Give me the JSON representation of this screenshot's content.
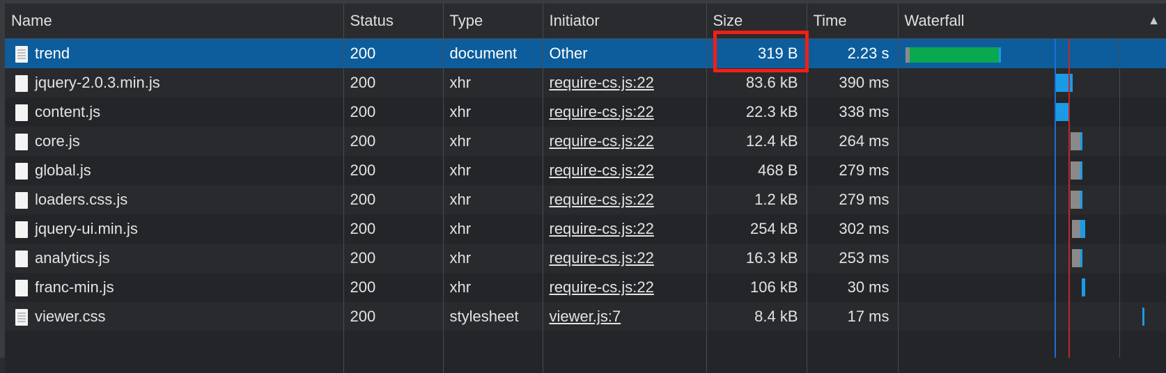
{
  "columns": {
    "name": "Name",
    "status": "Status",
    "type": "Type",
    "initiator": "Initiator",
    "size": "Size",
    "time": "Time",
    "waterfall": "Waterfall"
  },
  "sort_indicator": "▲",
  "rows": [
    {
      "name": "trend",
      "status": "200",
      "type": "document",
      "initiator": "Other",
      "size": "319 B",
      "time": "2.23 s"
    },
    {
      "name": "jquery-2.0.3.min.js",
      "status": "200",
      "type": "xhr",
      "initiator": "require-cs.js:22",
      "size": "83.6 kB",
      "time": "390 ms"
    },
    {
      "name": "content.js",
      "status": "200",
      "type": "xhr",
      "initiator": "require-cs.js:22",
      "size": "22.3 kB",
      "time": "338 ms"
    },
    {
      "name": "core.js",
      "status": "200",
      "type": "xhr",
      "initiator": "require-cs.js:22",
      "size": "12.4 kB",
      "time": "264 ms"
    },
    {
      "name": "global.js",
      "status": "200",
      "type": "xhr",
      "initiator": "require-cs.js:22",
      "size": "468 B",
      "time": "279 ms"
    },
    {
      "name": "loaders.css.js",
      "status": "200",
      "type": "xhr",
      "initiator": "require-cs.js:22",
      "size": "1.2 kB",
      "time": "279 ms"
    },
    {
      "name": "jquery-ui.min.js",
      "status": "200",
      "type": "xhr",
      "initiator": "require-cs.js:22",
      "size": "254 kB",
      "time": "302 ms"
    },
    {
      "name": "analytics.js",
      "status": "200",
      "type": "xhr",
      "initiator": "require-cs.js:22",
      "size": "16.3 kB",
      "time": "253 ms"
    },
    {
      "name": "franc-min.js",
      "status": "200",
      "type": "xhr",
      "initiator": "require-cs.js:22",
      "size": "106 kB",
      "time": "30 ms"
    },
    {
      "name": "viewer.css",
      "status": "200",
      "type": "stylesheet",
      "initiator": "viewer.js:7",
      "size": "8.4 kB",
      "time": "17 ms"
    }
  ],
  "colors": {
    "selected_row": "#0d5d9c",
    "highlight_box": "#f21f14",
    "waterfall_green": "#0aa84f",
    "waterfall_blue": "#1a9be6",
    "waterfall_gray": "#8a8a8a",
    "dom_content_line": "#1b6fd6",
    "load_line": "#c0262a"
  }
}
